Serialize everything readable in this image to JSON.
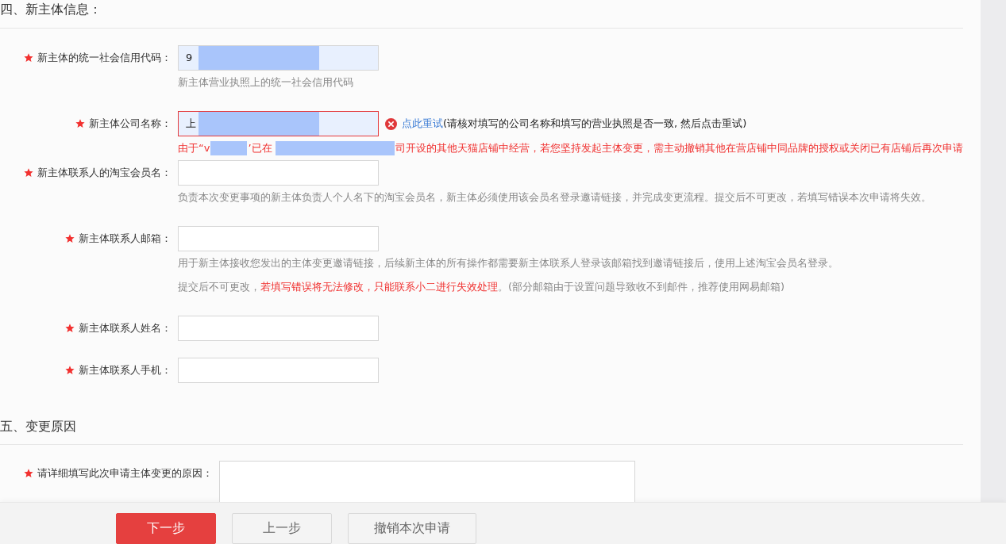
{
  "sections": [
    {
      "title": "四、新主体信息：",
      "fields": [
        {
          "kind": "input",
          "label": "新主体的统一社会信用代码：",
          "required": true,
          "value": "9",
          "autofilled": true,
          "invalid": false,
          "redacted": true,
          "hints": [
            {
              "parts": [
                {
                  "text": "新主体营业执照上的统一社会信用代码",
                  "warning": false
                }
              ]
            }
          ]
        },
        {
          "kind": "input",
          "label": "新主体公司名称：",
          "required": true,
          "value": "上",
          "autofilled": true,
          "invalid": true,
          "redacted": true,
          "retry": {
            "link": "点此重试",
            "note": "(请核对填写的公司名称和填写的营业执照是否一致, 然后点击重试)"
          },
          "error": [
            {
              "kind": "text",
              "text": "由于“v"
            },
            {
              "kind": "redacted"
            },
            {
              "kind": "text",
              "text": "’已在"
            },
            {
              "kind": "redacted"
            },
            {
              "kind": "text",
              "text": "司开设的其他天猫店铺中经营，若您坚持发起主体变更，需主动撤销其他在营店铺中同品牌的授权或关闭已有店铺后再次申请"
            }
          ]
        },
        {
          "kind": "input",
          "label": "新主体联系人的淘宝会员名：",
          "required": true,
          "autofilled": false,
          "invalid": false,
          "redacted": false,
          "hints": [
            {
              "parts": [
                {
                  "text": "负责本次变更事项的新主体负责人个人名下的淘宝会员名，新主体必须使用该会员名登录邀请链接，并完成变更流程。提交后不可更改，若填写错误本次申请将失效。",
                  "warning": false
                }
              ]
            }
          ]
        },
        {
          "kind": "input",
          "label": "新主体联系人邮箱：",
          "required": true,
          "autofilled": false,
          "invalid": false,
          "redacted": false,
          "hints": [
            {
              "parts": [
                {
                  "text": "用于新主体接收您发出的主体变更邀请链接，后续新主体的所有操作都需要新主体联系人登录该邮箱找到邀请链接后，使用上述淘宝会员名登录。",
                  "warning": false
                }
              ]
            },
            {
              "parts": [
                {
                  "text": "提交后不可更改，",
                  "warning": false
                },
                {
                  "text": "若填写错误将无法修改，只能联系小二进行失效处理",
                  "warning": true
                },
                {
                  "text": "。(部分邮箱由于设置问题导致收不到邮件，推荐使用网易邮箱)",
                  "warning": false
                }
              ]
            }
          ]
        },
        {
          "kind": "input",
          "label": "新主体联系人姓名：",
          "required": true,
          "autofilled": false,
          "invalid": false,
          "redacted": false
        },
        {
          "kind": "input",
          "label": "新主体联系人手机：",
          "required": true,
          "autofilled": false,
          "invalid": false,
          "redacted": false
        }
      ]
    },
    {
      "title": "五、变更原因",
      "fields": [
        {
          "kind": "textarea",
          "label": "请详细填写此次申请主体变更的原因：",
          "required": true,
          "autofilled": false,
          "invalid": false,
          "redacted": false
        }
      ]
    }
  ],
  "buttons": [
    {
      "label": "下一步",
      "kind": "primary"
    },
    {
      "label": "上一步",
      "kind": "default"
    },
    {
      "label": "撤销本次申请",
      "kind": "default"
    }
  ]
}
